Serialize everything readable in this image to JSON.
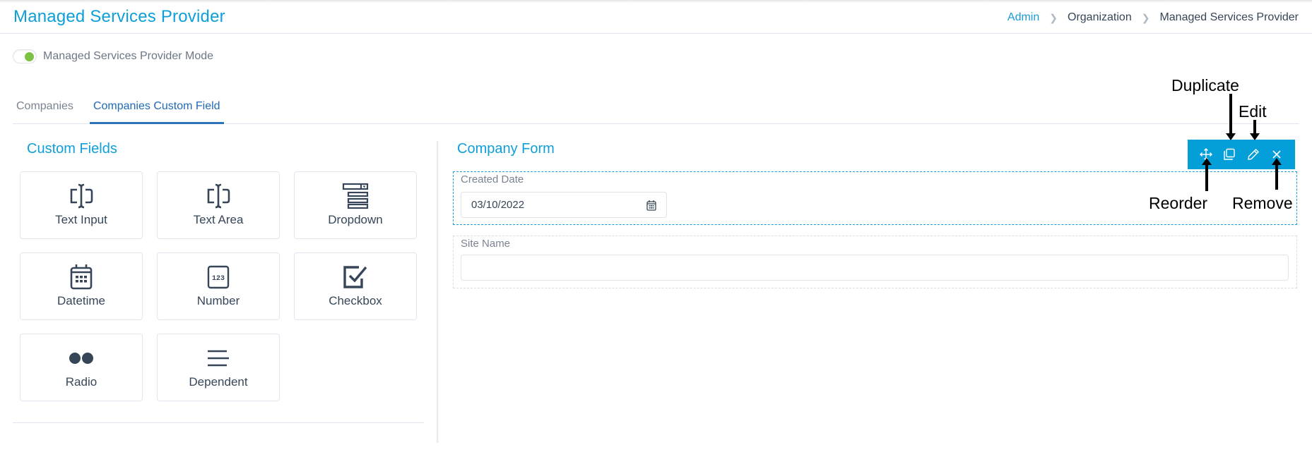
{
  "header": {
    "title": "Managed Services Provider",
    "breadcrumb": [
      "Admin",
      "Organization",
      "Managed Services Provider"
    ]
  },
  "msp_mode": {
    "label": "Managed Services Provider Mode",
    "enabled": true
  },
  "tabs": [
    {
      "label": "Companies",
      "active": false
    },
    {
      "label": "Companies Custom Field",
      "active": true
    }
  ],
  "custom_fields": {
    "title": "Custom Fields",
    "items": [
      {
        "label": "Text Input",
        "icon": "text-cursor-icon"
      },
      {
        "label": "Text Area",
        "icon": "text-cursor-icon"
      },
      {
        "label": "Dropdown",
        "icon": "dropdown-list-icon"
      },
      {
        "label": "Datetime",
        "icon": "calendar-icon"
      },
      {
        "label": "Number",
        "icon": "number-123-icon"
      },
      {
        "label": "Checkbox",
        "icon": "checkbox-icon"
      },
      {
        "label": "Radio",
        "icon": "radio-dots-icon"
      },
      {
        "label": "Dependent",
        "icon": "lines-icon"
      }
    ]
  },
  "company_form": {
    "title": "Company Form",
    "fields": [
      {
        "label": "Created Date",
        "value": "03/10/2022",
        "type": "date"
      },
      {
        "label": "Site Name",
        "value": "",
        "type": "text"
      }
    ],
    "toolbar": [
      "Reorder",
      "Duplicate",
      "Edit",
      "Remove"
    ]
  },
  "annotations": {
    "duplicate": "Duplicate",
    "edit": "Edit",
    "reorder": "Reorder",
    "remove": "Remove"
  },
  "colors": {
    "accent": "#0e9fd8",
    "tab_active": "#2c72b8",
    "toolbar_bg": "#049ed9",
    "toggle_on": "#7cc242",
    "text": "#364658"
  }
}
